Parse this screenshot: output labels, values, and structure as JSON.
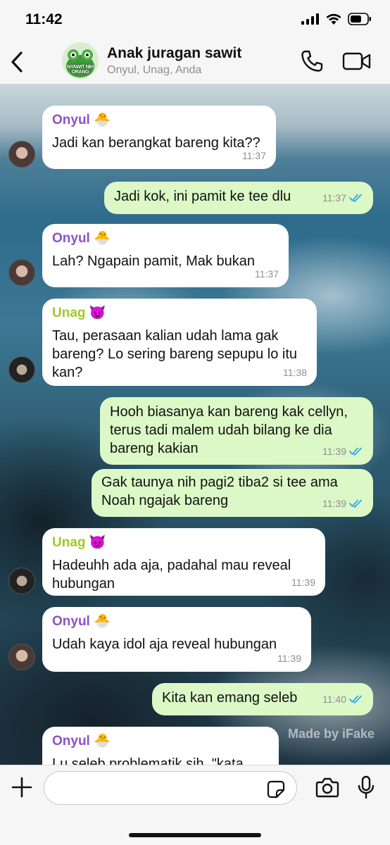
{
  "status": {
    "time": "11:42"
  },
  "header": {
    "title": "Anak juragan sawit",
    "members": "Onyul, Unag, Anda",
    "avatar_text": "NYAWIT NIH ORANG"
  },
  "colors": {
    "onyul": "#8c52c8",
    "unag": "#a2c82a",
    "outgoing": "#dcf8c6",
    "tick": "#34a6e8"
  },
  "messages": [
    {
      "sender": "Onyul",
      "emoji": "🐣",
      "text": "Jadi kan berangkat bareng kita??",
      "time": "11:37"
    },
    {
      "text": "Jadi kok, ini pamit ke tee dlu",
      "time": "11:37"
    },
    {
      "sender": "Onyul",
      "emoji": "🐣",
      "text": "Lah? Ngapain pamit, Mak bukan",
      "time": "11:37"
    },
    {
      "sender": "Unag",
      "emoji": "😈",
      "text": "Tau, perasaan kalian udah lama gak bareng? Lo sering bareng sepupu lo itu kan?",
      "time": "11:38"
    },
    {
      "text": "Hooh biasanya kan bareng kak cellyn, terus tadi malem udah bilang ke dia bareng kakian",
      "time": "11:39"
    },
    {
      "text": "Gak taunya nih pagi2 tiba2 si tee ama Noah ngajak bareng",
      "time": "11:39"
    },
    {
      "sender": "Unag",
      "emoji": "😈",
      "text": "Hadeuhh ada aja, padahal mau reveal hubungan",
      "time": "11:39"
    },
    {
      "sender": "Onyul",
      "emoji": "🐣",
      "text": "Udah kaya idol aja reveal hubungan",
      "time": "11:39"
    },
    {
      "text": "Kita kan emang seleb",
      "time": "11:40"
    },
    {
      "sender": "Onyul",
      "emoji": "🐣",
      "text": "Lu seleb problematik sih, \"kata"
    }
  ],
  "watermark": "Made by iFake",
  "composer": {
    "placeholder": ""
  }
}
